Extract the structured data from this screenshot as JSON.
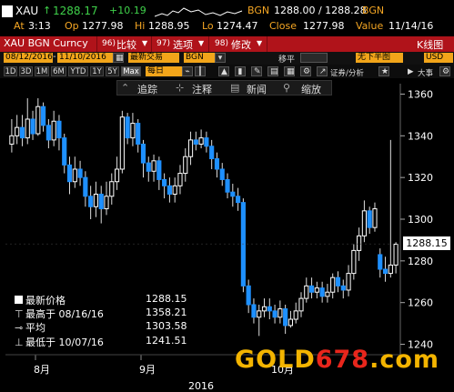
{
  "ticker": {
    "symbol": "XAU",
    "last": "1288.17",
    "change": "+10.19",
    "bgn_label": "BGN",
    "bid_ask": "1288.00 / 1288.28",
    "bid_ask_src": "BGN",
    "at_label": "At",
    "at_time": "3:13",
    "op_label": "Op",
    "op": "1277.98",
    "hi_label": "Hi",
    "hi": "1288.95",
    "lo_label": "Lo",
    "lo": "1274.47",
    "close_label": "Close",
    "close": "1277.98",
    "value_label": "Value",
    "value_date": "11/14/16"
  },
  "menubar": {
    "security": "XAU BGN Curncy",
    "compare": "比较",
    "compare_num": "96)",
    "options": "选项",
    "options_num": "97)",
    "edit": "修改",
    "edit_num": "98)",
    "chart_type": "K线图"
  },
  "controls": {
    "date_from": "08/12/2016",
    "date_to": "11/10/2016",
    "period": "最新交易",
    "source": "BGN",
    "move_label": "移平",
    "highlow": "无下半图",
    "currency": "USD",
    "ranges": [
      "1D",
      "3D",
      "1M",
      "6M",
      "YTD",
      "1Y",
      "5Y",
      "Max"
    ],
    "selected_range": "Max",
    "frequency": "每日",
    "analysis_label": "证券/分析",
    "size_label": "大事"
  },
  "toolbar": {
    "trend": "追踪",
    "annotate": "注释",
    "news": "新闻",
    "zoom": "缩放"
  },
  "legend": {
    "last_label": "最新价格",
    "last_value": "1288.15",
    "high_label": "最高于 08/16/16",
    "high_value": "1358.21",
    "avg_label": "平均",
    "avg_value": "1303.58",
    "low_label": "最低于 10/07/16",
    "low_value": "1241.51"
  },
  "price_box": "1288.15",
  "watermark": {
    "part1": "GOLD",
    "part2": "678",
    "part3": ".com"
  },
  "colors": {
    "up": "#ffffff",
    "down": "#1e90ff",
    "menubar": "#b0131a",
    "field": "#f2a51a",
    "ticker_label": "#f5a623",
    "change": "#3fd14a"
  },
  "chart_data": {
    "type": "candlestick",
    "title": "",
    "xlabel": "",
    "ylabel": "",
    "ylim": [
      1235,
      1365
    ],
    "yticks": [
      1240,
      1260,
      1280,
      1300,
      1320,
      1340,
      1360
    ],
    "x_tick_labels": [
      "8月",
      "9月",
      "10月"
    ],
    "year_label": "2016",
    "candles": [
      {
        "o": 1336,
        "c": 1340,
        "h": 1348,
        "l": 1332
      },
      {
        "o": 1340,
        "c": 1344,
        "h": 1350,
        "l": 1336
      },
      {
        "o": 1344,
        "c": 1339,
        "h": 1350,
        "l": 1335
      },
      {
        "o": 1339,
        "c": 1348,
        "h": 1358,
        "l": 1336
      },
      {
        "o": 1348,
        "c": 1341,
        "h": 1352,
        "l": 1338
      },
      {
        "o": 1341,
        "c": 1354,
        "h": 1358,
        "l": 1340
      },
      {
        "o": 1354,
        "c": 1345,
        "h": 1356,
        "l": 1342
      },
      {
        "o": 1345,
        "c": 1338,
        "h": 1348,
        "l": 1334
      },
      {
        "o": 1338,
        "c": 1347,
        "h": 1352,
        "l": 1335
      },
      {
        "o": 1347,
        "c": 1339,
        "h": 1350,
        "l": 1333
      },
      {
        "o": 1339,
        "c": 1326,
        "h": 1341,
        "l": 1322
      },
      {
        "o": 1326,
        "c": 1318,
        "h": 1330,
        "l": 1312
      },
      {
        "o": 1318,
        "c": 1324,
        "h": 1330,
        "l": 1315
      },
      {
        "o": 1324,
        "c": 1320,
        "h": 1328,
        "l": 1316
      },
      {
        "o": 1320,
        "c": 1311,
        "h": 1323,
        "l": 1306
      },
      {
        "o": 1311,
        "c": 1306,
        "h": 1316,
        "l": 1300
      },
      {
        "o": 1306,
        "c": 1312,
        "h": 1318,
        "l": 1301
      },
      {
        "o": 1312,
        "c": 1305,
        "h": 1316,
        "l": 1298
      },
      {
        "o": 1305,
        "c": 1311,
        "h": 1318,
        "l": 1302
      },
      {
        "o": 1311,
        "c": 1318,
        "h": 1322,
        "l": 1307
      },
      {
        "o": 1318,
        "c": 1324,
        "h": 1330,
        "l": 1314
      },
      {
        "o": 1324,
        "c": 1349,
        "h": 1352,
        "l": 1322
      },
      {
        "o": 1349,
        "c": 1339,
        "h": 1351,
        "l": 1336
      },
      {
        "o": 1339,
        "c": 1346,
        "h": 1351,
        "l": 1335
      },
      {
        "o": 1346,
        "c": 1336,
        "h": 1348,
        "l": 1332
      },
      {
        "o": 1336,
        "c": 1327,
        "h": 1338,
        "l": 1320
      },
      {
        "o": 1327,
        "c": 1323,
        "h": 1330,
        "l": 1318
      },
      {
        "o": 1323,
        "c": 1328,
        "h": 1331,
        "l": 1318
      },
      {
        "o": 1328,
        "c": 1319,
        "h": 1330,
        "l": 1314
      },
      {
        "o": 1319,
        "c": 1316,
        "h": 1322,
        "l": 1310
      },
      {
        "o": 1316,
        "c": 1312,
        "h": 1320,
        "l": 1308
      },
      {
        "o": 1312,
        "c": 1316,
        "h": 1320,
        "l": 1308
      },
      {
        "o": 1316,
        "c": 1322,
        "h": 1326,
        "l": 1312
      },
      {
        "o": 1322,
        "c": 1330,
        "h": 1334,
        "l": 1318
      },
      {
        "o": 1330,
        "c": 1338,
        "h": 1342,
        "l": 1326
      },
      {
        "o": 1338,
        "c": 1336,
        "h": 1342,
        "l": 1333
      },
      {
        "o": 1336,
        "c": 1339,
        "h": 1343,
        "l": 1334
      },
      {
        "o": 1339,
        "c": 1335,
        "h": 1342,
        "l": 1332
      },
      {
        "o": 1335,
        "c": 1329,
        "h": 1338,
        "l": 1324
      },
      {
        "o": 1329,
        "c": 1324,
        "h": 1332,
        "l": 1320
      },
      {
        "o": 1324,
        "c": 1319,
        "h": 1327,
        "l": 1316
      },
      {
        "o": 1319,
        "c": 1313,
        "h": 1322,
        "l": 1310
      },
      {
        "o": 1313,
        "c": 1311,
        "h": 1317,
        "l": 1306
      },
      {
        "o": 1311,
        "c": 1308,
        "h": 1315,
        "l": 1304
      },
      {
        "o": 1308,
        "c": 1268,
        "h": 1310,
        "l": 1265
      },
      {
        "o": 1268,
        "c": 1259,
        "h": 1271,
        "l": 1255
      },
      {
        "o": 1259,
        "c": 1253,
        "h": 1262,
        "l": 1250
      },
      {
        "o": 1253,
        "c": 1256,
        "h": 1259,
        "l": 1244
      },
      {
        "o": 1256,
        "c": 1258,
        "h": 1262,
        "l": 1253
      },
      {
        "o": 1258,
        "c": 1256,
        "h": 1262,
        "l": 1252
      },
      {
        "o": 1256,
        "c": 1253,
        "h": 1259,
        "l": 1250
      },
      {
        "o": 1253,
        "c": 1257,
        "h": 1261,
        "l": 1250
      },
      {
        "o": 1257,
        "c": 1249,
        "h": 1259,
        "l": 1245
      },
      {
        "o": 1249,
        "c": 1252,
        "h": 1256,
        "l": 1248
      },
      {
        "o": 1252,
        "c": 1256,
        "h": 1260,
        "l": 1250
      },
      {
        "o": 1256,
        "c": 1262,
        "h": 1265,
        "l": 1253
      },
      {
        "o": 1262,
        "c": 1268,
        "h": 1272,
        "l": 1260
      },
      {
        "o": 1268,
        "c": 1265,
        "h": 1272,
        "l": 1262
      },
      {
        "o": 1265,
        "c": 1267,
        "h": 1270,
        "l": 1262
      },
      {
        "o": 1267,
        "c": 1263,
        "h": 1270,
        "l": 1260
      },
      {
        "o": 1263,
        "c": 1265,
        "h": 1269,
        "l": 1260
      },
      {
        "o": 1265,
        "c": 1272,
        "h": 1274,
        "l": 1262
      },
      {
        "o": 1272,
        "c": 1268,
        "h": 1275,
        "l": 1265
      },
      {
        "o": 1268,
        "c": 1266,
        "h": 1271,
        "l": 1262
      },
      {
        "o": 1266,
        "c": 1274,
        "h": 1278,
        "l": 1263
      },
      {
        "o": 1274,
        "c": 1285,
        "h": 1288,
        "l": 1271
      },
      {
        "o": 1285,
        "c": 1292,
        "h": 1296,
        "l": 1280
      },
      {
        "o": 1292,
        "c": 1304,
        "h": 1309,
        "l": 1289
      },
      {
        "o": 1304,
        "c": 1296,
        "h": 1306,
        "l": 1293
      },
      {
        "o": 1296,
        "c": 1305,
        "h": 1308,
        "l": 1294
      },
      {
        "o": 1283,
        "c": 1276,
        "h": 1286,
        "l": 1272
      },
      {
        "o": 1276,
        "c": 1274,
        "h": 1282,
        "l": 1270
      },
      {
        "o": 1274,
        "c": 1278,
        "h": 1338,
        "l": 1272
      },
      {
        "o": 1278,
        "c": 1288,
        "h": 1289,
        "l": 1274
      }
    ]
  }
}
